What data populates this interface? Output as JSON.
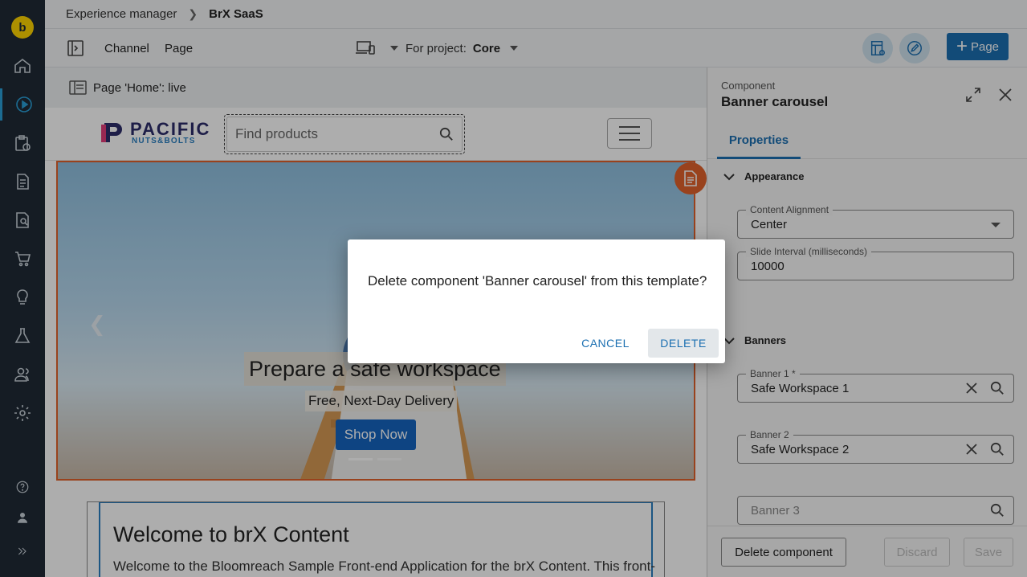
{
  "breadcrumb": {
    "first": "Experience manager",
    "second": "BrX SaaS"
  },
  "toolbar": {
    "channel_label": "Channel",
    "page_label": "Page",
    "project_label": "For project:",
    "project_value": "Core",
    "add_page_label": "Page"
  },
  "preview": {
    "page_status": "Page 'Home': live",
    "logo_line1": "PACIFIC",
    "logo_line2": "NUTS&BOLTS",
    "search_placeholder": "Find products",
    "banner_title": "Prepare a safe workspace",
    "banner_subtitle": "Free, Next-Day Delivery",
    "banner_button": "Shop Now",
    "welcome_title": "Welcome to brX Content",
    "welcome_text": "Welcome to the Bloomreach Sample Front-end Application for the brX Content. This front-end"
  },
  "panel": {
    "type_label": "Component",
    "name": "Banner carousel",
    "tab_properties": "Properties",
    "section_appearance": "Appearance",
    "section_banners": "Banners",
    "fields": {
      "content_alignment": {
        "label": "Content Alignment",
        "value": "Center"
      },
      "slide_interval": {
        "label": "Slide Interval (milliseconds)",
        "value": "10000"
      },
      "banner1": {
        "label": "Banner 1 *",
        "value": "Safe Workspace 1"
      },
      "banner2": {
        "label": "Banner 2",
        "value": "Safe Workspace 2"
      },
      "banner3": {
        "placeholder": "Banner 3"
      }
    },
    "footer": {
      "delete_component": "Delete component",
      "discard": "Discard",
      "save": "Save"
    }
  },
  "dialog": {
    "message": "Delete component 'Banner carousel' from this template?",
    "cancel": "CANCEL",
    "delete": "DELETE"
  },
  "colors": {
    "accent": "#1b6fb1",
    "rail": "#1f2a36",
    "highlight": "#e2622b",
    "logo": "#ffd500"
  }
}
